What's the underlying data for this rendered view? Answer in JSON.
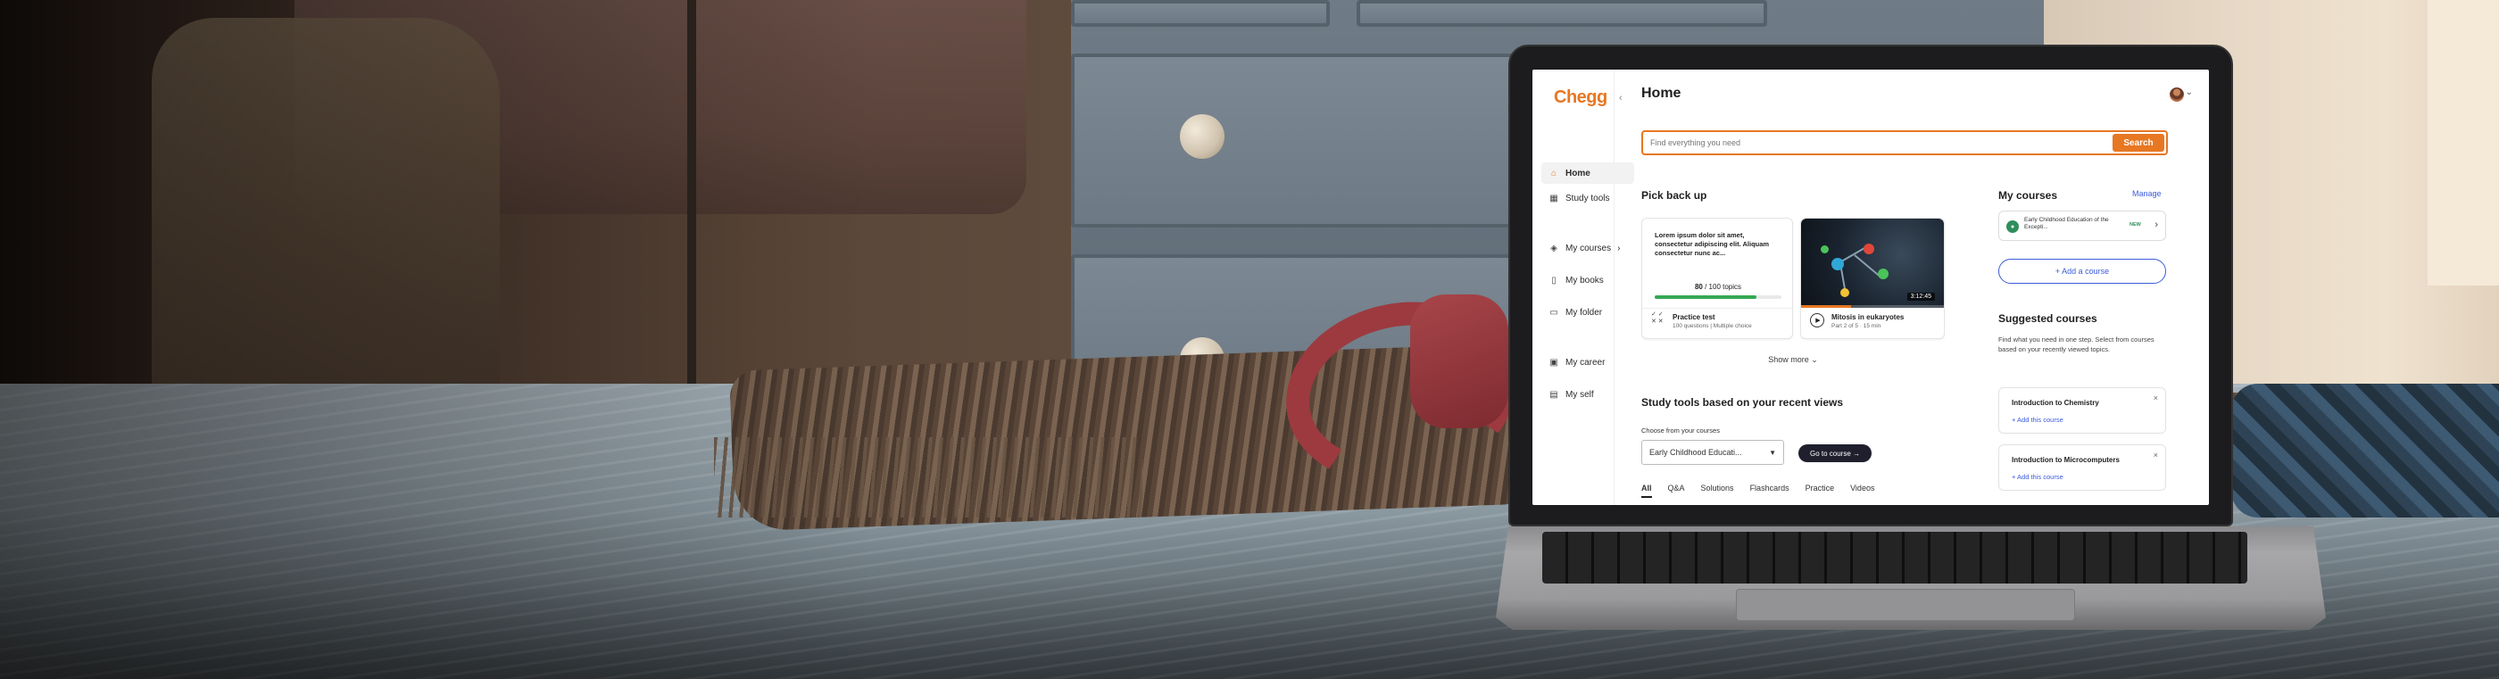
{
  "app": {
    "logo": "Chegg",
    "collapse_icon": "chevron-left-icon",
    "accent_color": "#e87722",
    "link_color": "#3b5bdb"
  },
  "sidebar": {
    "items": [
      {
        "label": "Home",
        "icon": "home-icon",
        "active": true
      },
      {
        "label": "Study tools",
        "icon": "grid-icon"
      },
      {
        "label": "My courses",
        "icon": "layers-icon",
        "chevron": "›"
      },
      {
        "label": "My books",
        "icon": "book-icon"
      },
      {
        "label": "My folder",
        "icon": "folder-icon"
      },
      {
        "label": "My career",
        "icon": "briefcase-icon"
      },
      {
        "label": "My self",
        "icon": "trash-icon"
      }
    ]
  },
  "header": {
    "title": "Home",
    "avatar_chevron": "⌄"
  },
  "search": {
    "placeholder": "Find everything you need",
    "button_label": "Search"
  },
  "pick_back_up": {
    "title": "Pick back up",
    "practice_card": {
      "text": "Lorem ipsum dolor sit amet, consectetur adipiscing elit. Aliquam consectetur nunc ac...",
      "progress_done": "80",
      "progress_total": "/ 100 topics",
      "progress_fraction": 0.8,
      "meta_title": "Practice test",
      "meta_sub": "100 questions  |  Multiple choice",
      "meta_icons": "✓ ✓\n✕ ✕"
    },
    "video_card": {
      "duration": "3:12:45",
      "progress_fraction": 0.35,
      "meta_title": "Mitosis in eukaryotes",
      "meta_sub": "Part 2 of 5  ·  15 min"
    },
    "show_more": "Show more ⌄"
  },
  "study_tools": {
    "title": "Study tools based on your recent views",
    "choose_label": "Choose from your courses",
    "selected_course": "Early Childhood Educati...",
    "go_button": "Go to course →",
    "tabs": [
      "All",
      "Q&A",
      "Solutions",
      "Flashcards",
      "Practice",
      "Videos"
    ]
  },
  "my_courses": {
    "title": "My courses",
    "manage": "Manage",
    "course": {
      "name": "Early Childhood Education of the Excepti...",
      "tag": "NEW"
    },
    "add_course": "+ Add a course"
  },
  "suggested": {
    "title": "Suggested courses",
    "description": "Find what you need in one step. Select from courses based on your recently viewed topics.",
    "items": [
      {
        "title": "Introduction to Chemistry",
        "action": "+ Add this course"
      },
      {
        "title": "Introduction to Microcomputers",
        "action": "+ Add this course"
      }
    ],
    "close_icon": "×"
  }
}
